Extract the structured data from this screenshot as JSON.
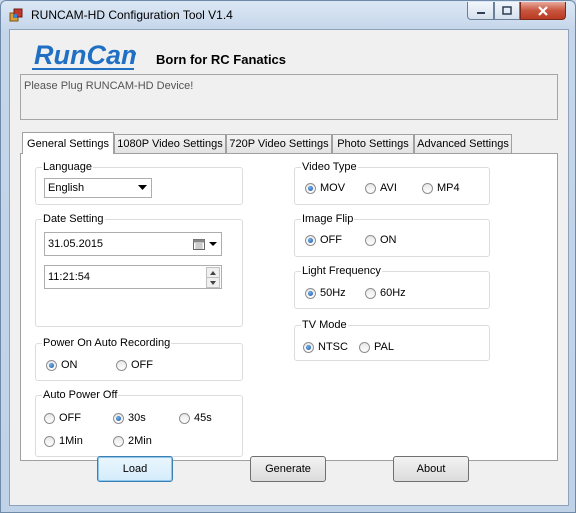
{
  "window": {
    "title": "RUNCAM-HD Configuration Tool V1.4"
  },
  "header": {
    "logo_text": "RunCam",
    "slogan": "Born for RC Fanatics"
  },
  "status": {
    "message": "Please Plug RUNCAM-HD Device!"
  },
  "tabs": [
    {
      "label": "General Settings",
      "active": true
    },
    {
      "label": "1080P Video Settings"
    },
    {
      "label": "720P Video Settings"
    },
    {
      "label": "Photo Settings"
    },
    {
      "label": "Advanced Settings"
    }
  ],
  "language": {
    "label": "Language",
    "value": "English"
  },
  "date_setting": {
    "label": "Date Setting",
    "date": "31.05.2015",
    "time": "11:21:54"
  },
  "power_on_auto_recording": {
    "label": "Power On Auto Recording",
    "options": [
      "ON",
      "OFF"
    ],
    "selected": "ON"
  },
  "auto_power_off": {
    "label": "Auto Power Off",
    "options": [
      "OFF",
      "30s",
      "45s",
      "1Min",
      "2Min"
    ],
    "selected": "30s"
  },
  "video_type": {
    "label": "Video Type",
    "options": [
      "MOV",
      "AVI",
      "MP4"
    ],
    "selected": "MOV"
  },
  "image_flip": {
    "label": "Image Flip",
    "options": [
      "OFF",
      "ON"
    ],
    "selected": "OFF"
  },
  "light_frequency": {
    "label": "Light Frequency",
    "options": [
      "50Hz",
      "60Hz"
    ],
    "selected": "50Hz"
  },
  "tv_mode": {
    "label": "TV Mode",
    "options": [
      "NTSC",
      "PAL"
    ],
    "selected": "NTSC"
  },
  "buttons": {
    "load": "Load",
    "generate": "Generate",
    "about": "About"
  },
  "colors": {
    "accent_blue": "#1a63b5",
    "logo_blue": "#1f6fc4",
    "close_red": "#c8553e"
  }
}
